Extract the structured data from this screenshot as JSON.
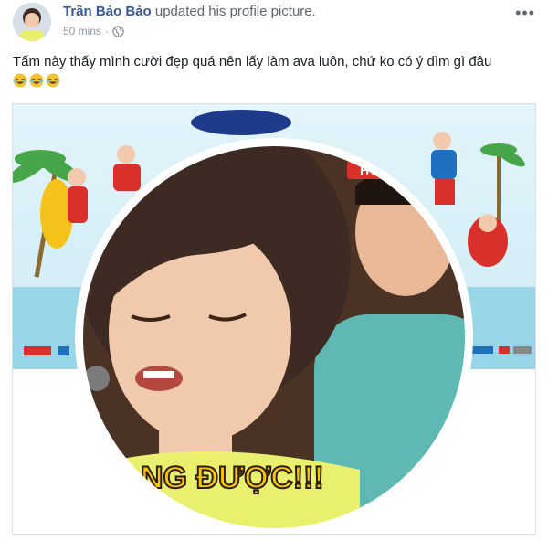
{
  "post": {
    "author": "Trần Bảo Bảo",
    "action": "updated his profile picture.",
    "timestamp": "50 mins",
    "separator": "·",
    "more_label": "•••",
    "caption": "Tấm này thấy mình cười đẹp quá nên lấy làm ava luôn, chứ ko có ý dìm gì đâu",
    "emoji_names": [
      "rofl-emoji",
      "rofl-emoji",
      "rofl-emoji"
    ]
  },
  "photo": {
    "logo_text": "HTV",
    "shirt_caption": "NG ĐƯỢC!!!",
    "colors": {
      "sky": "#bfe6f2",
      "sea": "#73c7e0",
      "frame": "#ffffff",
      "shirt": "#e9f06e",
      "hair": "#3d2a22",
      "skin": "#f1c9ad",
      "teal_shirt": "#5fb8b2"
    }
  },
  "colors": {
    "link": "#385898",
    "muted": "#90949c",
    "text": "#1c1e21"
  }
}
